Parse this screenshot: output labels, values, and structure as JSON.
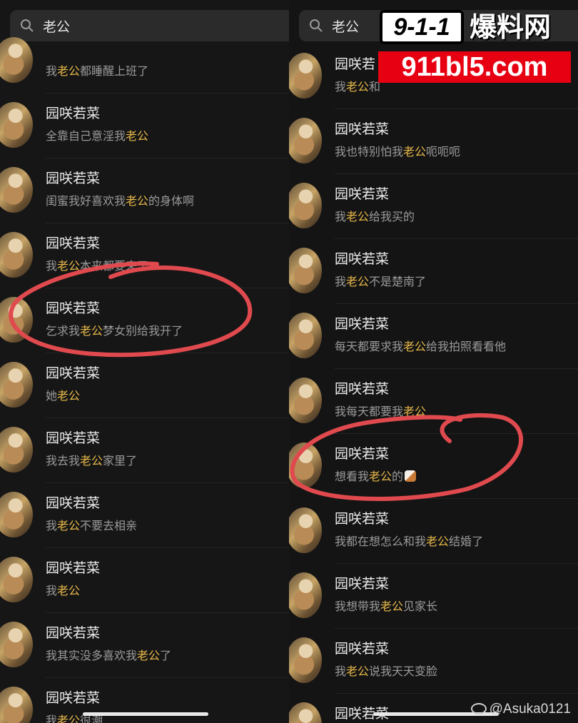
{
  "left": {
    "search_query": "老公",
    "rows": [
      {
        "name": "",
        "msg_pre": "我",
        "msg_hl": "老公",
        "msg_post": "都睡醒上班了"
      },
      {
        "name": "园咲若菜",
        "msg_pre": "全靠自己意淫我",
        "msg_hl": "老公",
        "msg_post": ""
      },
      {
        "name": "园咲若菜",
        "msg_pre": "闺蜜我好喜欢我",
        "msg_hl": "老公",
        "msg_post": "的身体啊"
      },
      {
        "name": "园咲若菜",
        "msg_pre": "我",
        "msg_hl": "老公",
        "msg_post": "本来都要来了"
      },
      {
        "name": "园咲若菜",
        "msg_pre": "乞求我",
        "msg_hl": "老公",
        "msg_post": "梦女别给我开了"
      },
      {
        "name": "园咲若菜",
        "msg_pre": "她",
        "msg_hl": "老公",
        "msg_post": ""
      },
      {
        "name": "园咲若菜",
        "msg_pre": "我去我",
        "msg_hl": "老公",
        "msg_post": "家里了"
      },
      {
        "name": "园咲若菜",
        "msg_pre": "我",
        "msg_hl": "老公",
        "msg_post": "不要去相亲"
      },
      {
        "name": "园咲若菜",
        "msg_pre": "我",
        "msg_hl": "老公",
        "msg_post": ""
      },
      {
        "name": "园咲若菜",
        "msg_pre": "我其实没多喜欢我",
        "msg_hl": "老公",
        "msg_post": "了"
      },
      {
        "name": "园咲若菜",
        "msg_pre": "我",
        "msg_hl": "老公",
        "msg_post": "很潮"
      }
    ]
  },
  "right": {
    "search_query": "老公",
    "rows": [
      {
        "name": "园咲若",
        "msg_pre": "我",
        "msg_hl": "老公",
        "msg_post": "和"
      },
      {
        "name": "园咲若菜",
        "msg_pre": "我也特别怕我",
        "msg_hl": "老公",
        "msg_post": "呃呃呃"
      },
      {
        "name": "园咲若菜",
        "msg_pre": "我",
        "msg_hl": "老公",
        "msg_post": "给我买的"
      },
      {
        "name": "园咲若菜",
        "msg_pre": "我",
        "msg_hl": "老公",
        "msg_post": "不是楚南了"
      },
      {
        "name": "园咲若菜",
        "msg_pre": "每天都要求我",
        "msg_hl": "老公",
        "msg_post": "给我拍照看看他"
      },
      {
        "name": "园咲若菜",
        "msg_pre": "我每天都要我",
        "msg_hl": "老公",
        "msg_post": ""
      },
      {
        "name": "园咲若菜",
        "msg_pre": "想看我",
        "msg_hl": "老公",
        "msg_post": "的",
        "emoji": "rooster-emoji"
      },
      {
        "name": "园咲若菜",
        "msg_pre": "我都在想怎么和我",
        "msg_hl": "老公",
        "msg_post": "结婚了"
      },
      {
        "name": "园咲若菜",
        "msg_pre": "我想带我",
        "msg_hl": "老公",
        "msg_post": "见家长"
      },
      {
        "name": "园咲若菜",
        "msg_pre": "我",
        "msg_hl": "老公",
        "msg_post": "说我天天变脸"
      },
      {
        "name": "园咲若菜",
        "msg_pre": "",
        "msg_hl": "",
        "msg_post": ""
      }
    ]
  },
  "overlay": {
    "badge_text": "9-1-1",
    "brand_text": "爆料网",
    "url_text": "911bl5.com",
    "watermark_text": "@Asuka0121",
    "circle_color": "#e04a4e",
    "highlight_color": "#e6b84a",
    "url_bg_color": "#e60012"
  }
}
